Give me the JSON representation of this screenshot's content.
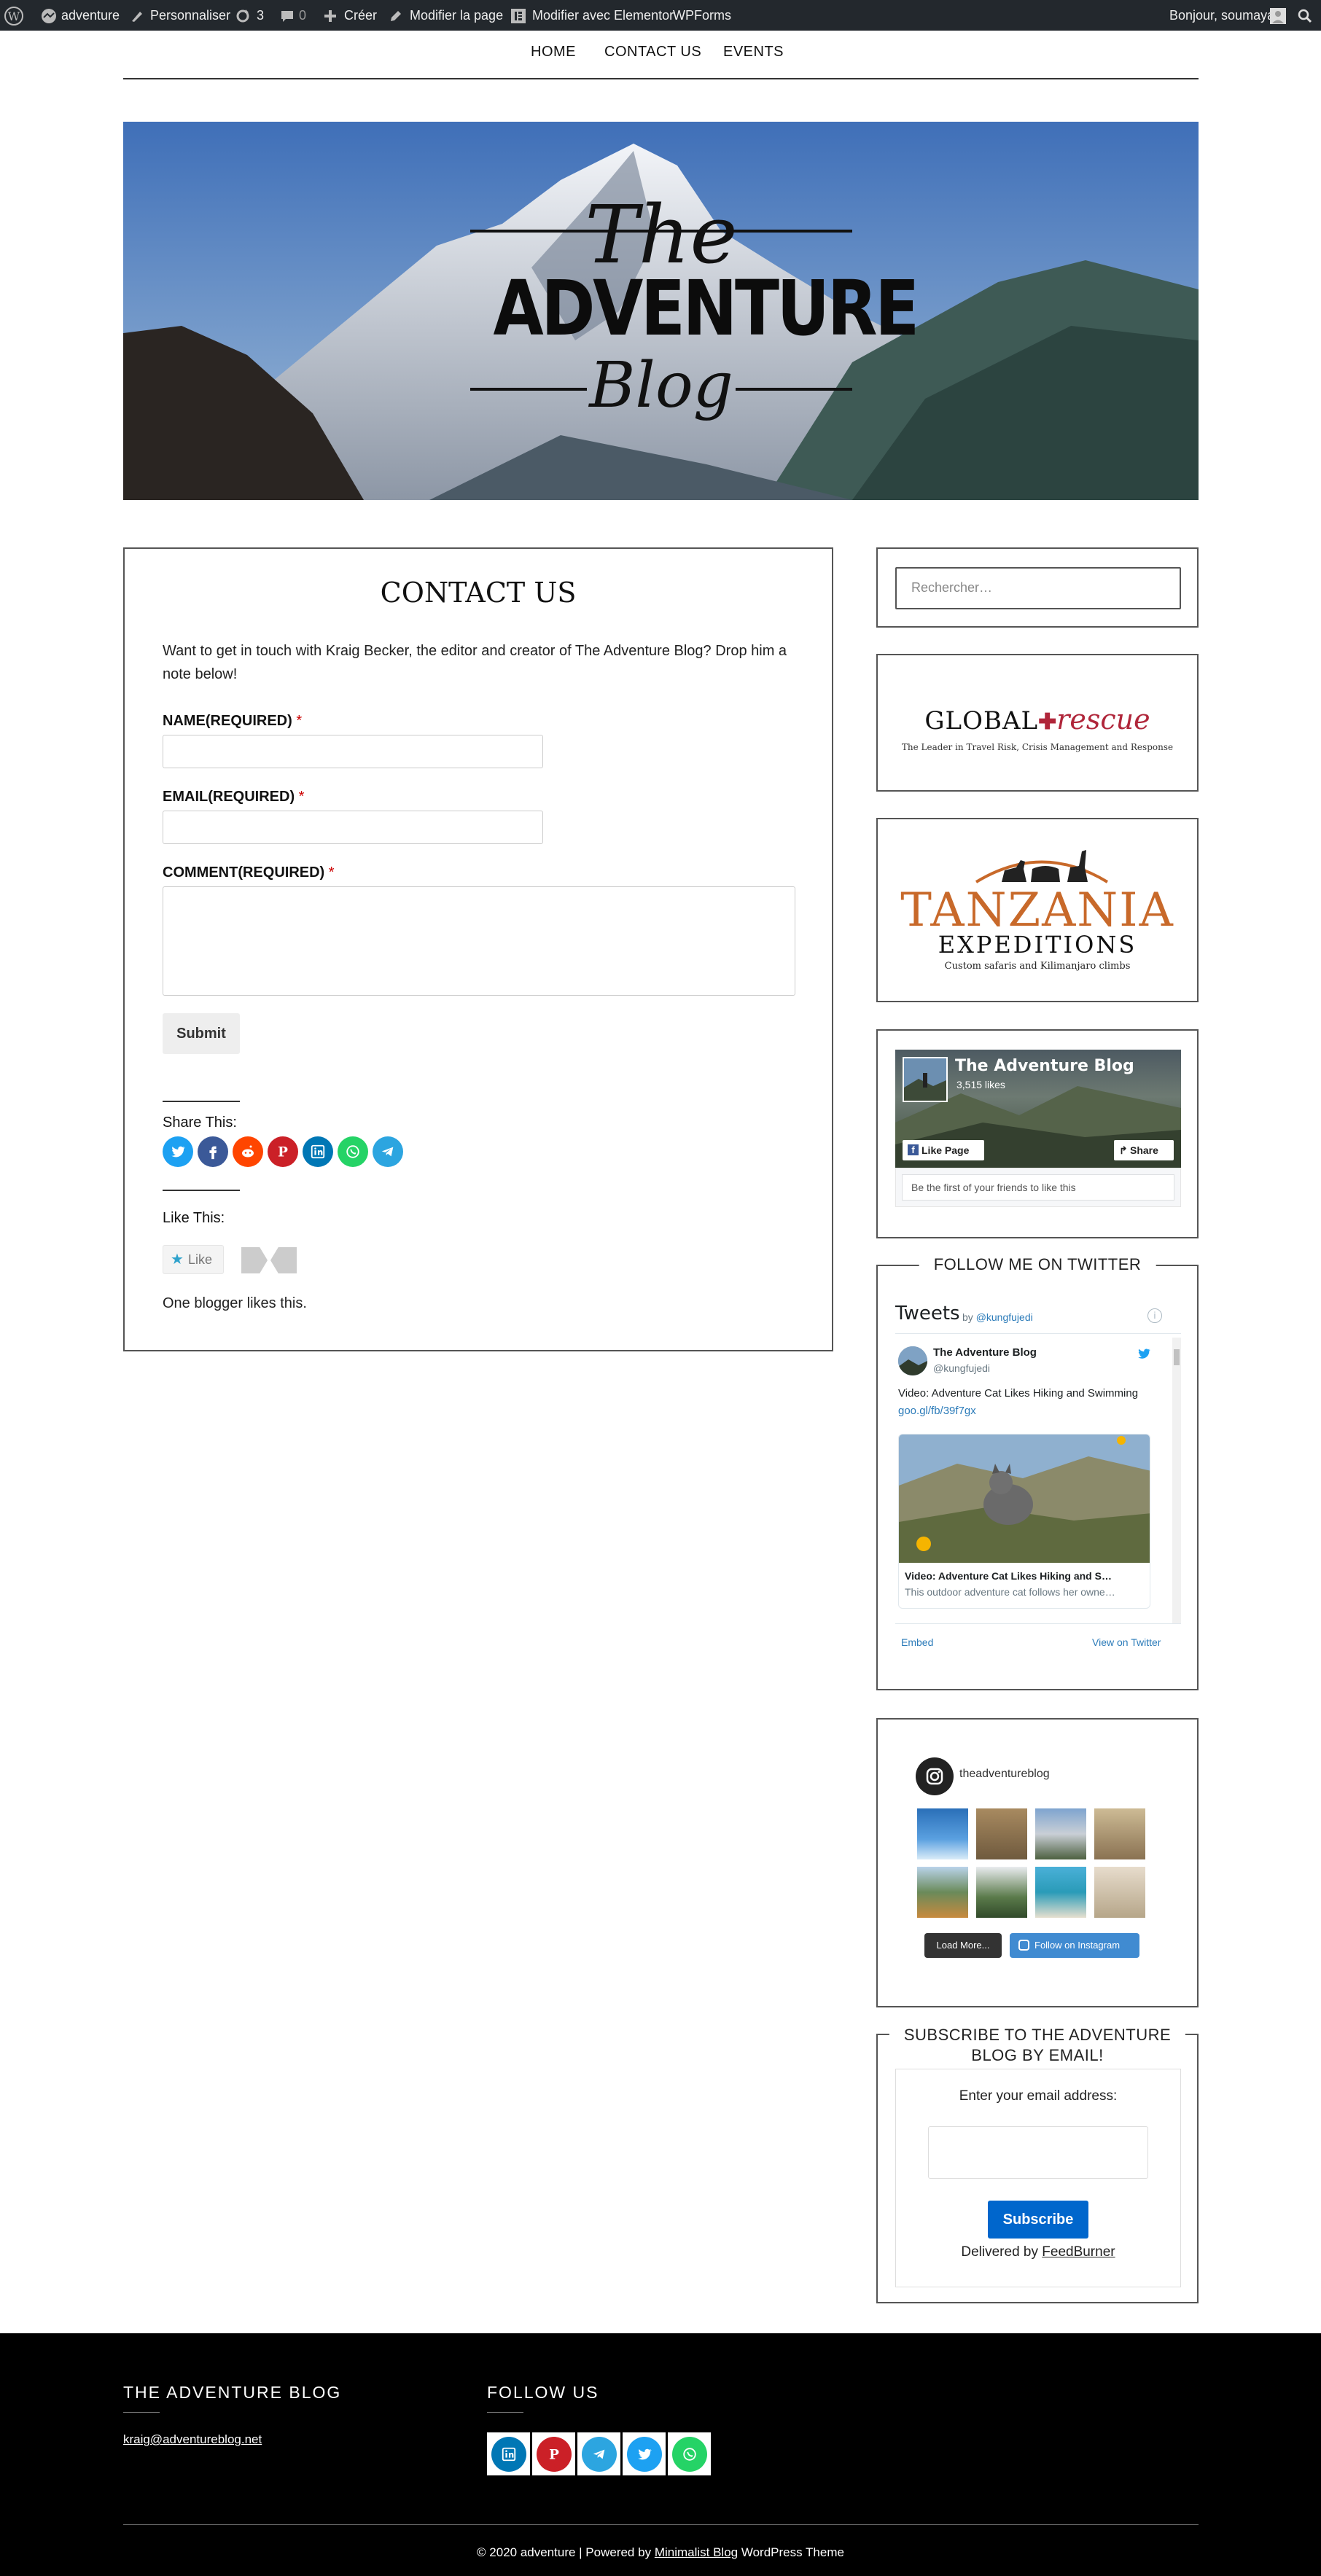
{
  "adminbar": {
    "site": "adventure",
    "customize": "Personnaliser",
    "updates": "3",
    "comments": "0",
    "create": "Créer",
    "edit_page": "Modifier la page",
    "edit_elementor": "Modifier avec Elementor",
    "wpforms": "WPForms",
    "greeting": "Bonjour, soumaya"
  },
  "nav": {
    "home": "HOME",
    "contact": "CONTACT US",
    "events": "EVENTS"
  },
  "hero": {
    "line1": "The",
    "line2": "ADVENTURE",
    "line3": "Blog"
  },
  "contact": {
    "title": "CONTACT US",
    "intro": "Want to get in touch with Kraig Becker, the editor and creator of The Adventure Blog? Drop him a note below!",
    "name_label": "NAME(REQUIRED)",
    "email_label": "EMAIL(REQUIRED)",
    "comment_label": "COMMENT(REQUIRED)",
    "required_mark": "*",
    "submit": "Submit",
    "share_title": "Share This:",
    "like_title": "Like This:",
    "like_button": "Like",
    "likes_text": "One blogger likes this."
  },
  "sidebar": {
    "search_placeholder": "Rechercher…",
    "global_rescue": {
      "name_left": "GLOBAL",
      "name_right": "rescue",
      "tagline": "The Leader in Travel Risk, Crisis Management and Response"
    },
    "tanzania": {
      "name": "TANZANIA",
      "sub": "EXPEDITIONS",
      "tagline": "Custom safaris and Kilimanjaro climbs"
    },
    "facebook": {
      "page": "The Adventure Blog",
      "likes": "3,515 likes",
      "like_page": "Like Page",
      "share": "Share",
      "friends": "Be the first of your friends to like this"
    },
    "twitter": {
      "title": "FOLLOW ME ON TWITTER",
      "tweets": "Tweets",
      "by": "by",
      "handle": "@kungfujedi",
      "author": "The Adventure Blog",
      "author_handle": "@kungfujedi",
      "text": "Video: Adventure Cat Likes Hiking and Swimming",
      "link": "goo.gl/fb/39f7gx",
      "card_title": "Video: Adventure Cat Likes Hiking and S…",
      "card_desc": "This outdoor adventure cat follows her owne…",
      "embed": "Embed",
      "view": "View on Twitter"
    },
    "instagram": {
      "username": "theadventureblog",
      "load_more": "Load More...",
      "follow": "Follow on Instagram"
    },
    "subscribe": {
      "title_line1": "SUBSCRIBE TO THE ADVENTURE",
      "title_line2": "BLOG BY EMAIL!",
      "prompt": "Enter your email address:",
      "button": "Subscribe",
      "delivered": "Delivered by",
      "feedburner": "FeedBurner"
    }
  },
  "footer": {
    "blog_title": "THE ADVENTURE BLOG",
    "email": "kraig@adventureblog.net",
    "follow_title": "FOLLOW US",
    "copyright": "© 2020 adventure | Powered by",
    "theme_link": "Minimalist Blog",
    "theme_suffix": "WordPress Theme"
  },
  "colors": {
    "accent_blue": "#0066cc",
    "adminbar": "#23282d",
    "required": "#cc0000"
  }
}
